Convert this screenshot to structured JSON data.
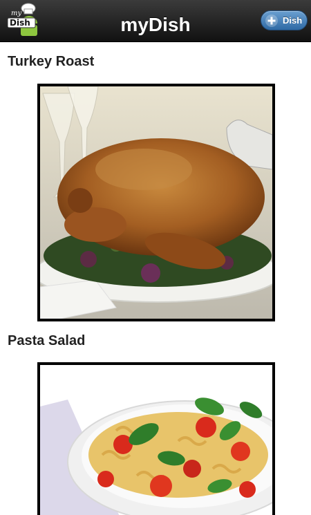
{
  "header": {
    "title": "myDish",
    "logo_text_top": "my",
    "logo_text_main": "Dish",
    "add_button_label": "Dish",
    "add_button_icon": "plus-icon"
  },
  "dishes": [
    {
      "name": "Turkey Roast"
    },
    {
      "name": "Pasta Salad"
    }
  ],
  "colors": {
    "header_top": "#3b3b3b",
    "header_bottom": "#111111",
    "button_blue": "#2f6aa5",
    "text_dark": "#222222"
  }
}
